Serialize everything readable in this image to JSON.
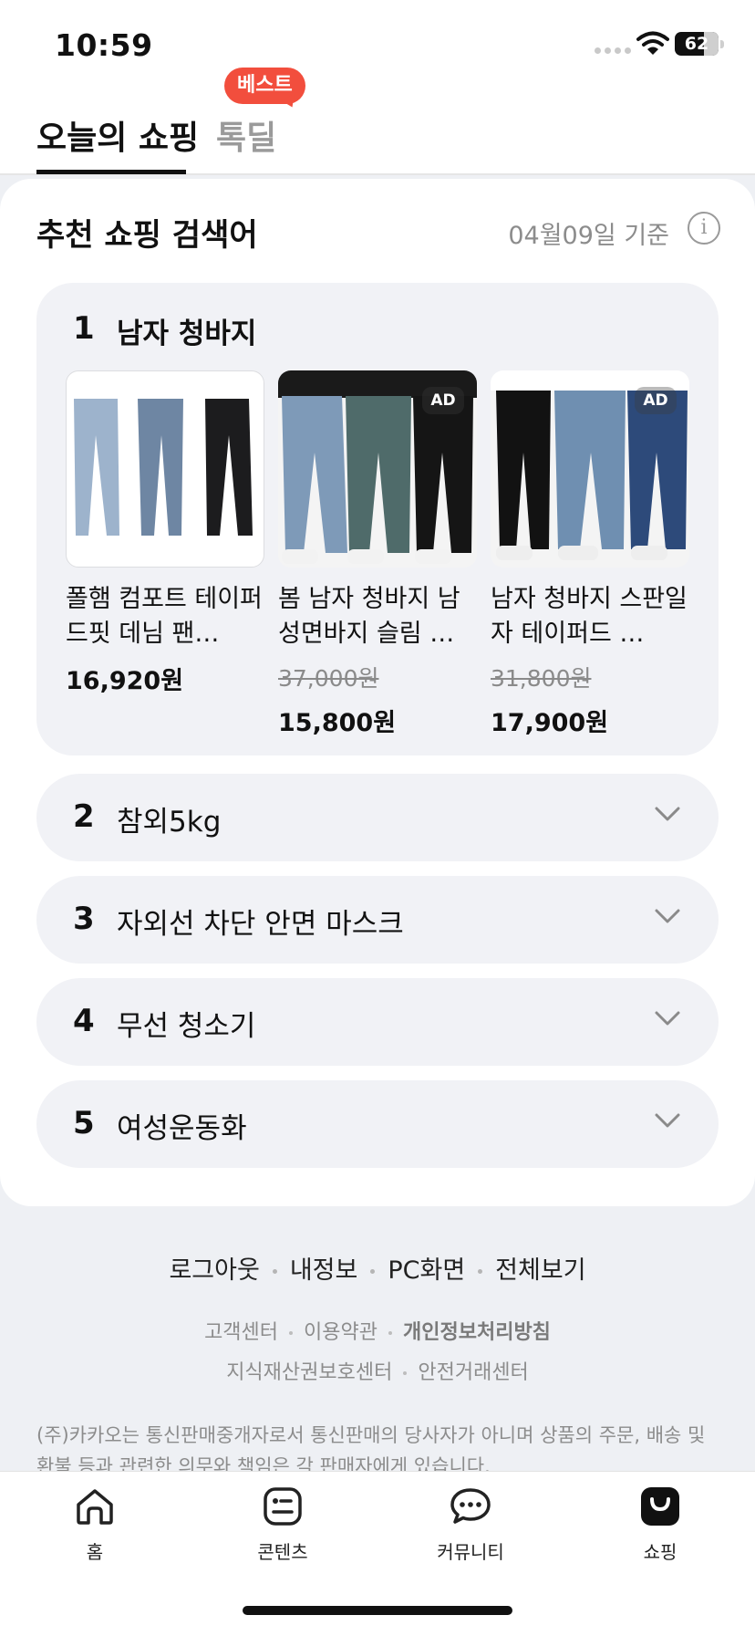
{
  "status_bar": {
    "time": "10:59",
    "battery": "62"
  },
  "tabs": {
    "today_shopping": "오늘의 쇼핑",
    "deal": "톡딜",
    "badge": "베스트"
  },
  "section": {
    "title": "추천 쇼핑 검색어",
    "date": "04월09일 기준"
  },
  "keywords": [
    {
      "rank": "1",
      "label": "남자 청바지",
      "products": [
        {
          "name": "폴햄 컴포트 테이퍼드핏 데님 팬…",
          "old_price": "",
          "price": "16,920원",
          "ad": ""
        },
        {
          "name": "봄 남자 청바지 남성면바지 슬림 …",
          "old_price": "37,000원",
          "price": "15,800원",
          "ad": "AD"
        },
        {
          "name": "남자 청바지 스판일자 테이퍼드 …",
          "old_price": "31,800원",
          "price": "17,900원",
          "ad": "AD"
        }
      ]
    },
    {
      "rank": "2",
      "label": "참외5kg"
    },
    {
      "rank": "3",
      "label": "자외선 차단 안면 마스크"
    },
    {
      "rank": "4",
      "label": "무선 청소기"
    },
    {
      "rank": "5",
      "label": "여성운동화"
    }
  ],
  "footer": {
    "links": [
      "로그아웃",
      "내정보",
      "PC화면",
      "전체보기"
    ],
    "sub1": [
      "고객센터",
      "이용약관",
      "개인정보처리방침"
    ],
    "sub2": [
      "지식재산권보호센터",
      "안전거래센터"
    ],
    "disclaimer": "(주)카카오는 통신판매중개자로서 통신판매의 당사자가 아니며 상품의 주문, 배송 및 환불 등과 관련한 의무와 책임은 각 판매자에게 있습니다."
  },
  "bottom_nav": [
    {
      "label": "홈",
      "icon": "home-icon"
    },
    {
      "label": "콘텐츠",
      "icon": "content-icon"
    },
    {
      "label": "커뮤니티",
      "icon": "community-icon"
    },
    {
      "label": "쇼핑",
      "icon": "shopping-bag-icon"
    }
  ]
}
